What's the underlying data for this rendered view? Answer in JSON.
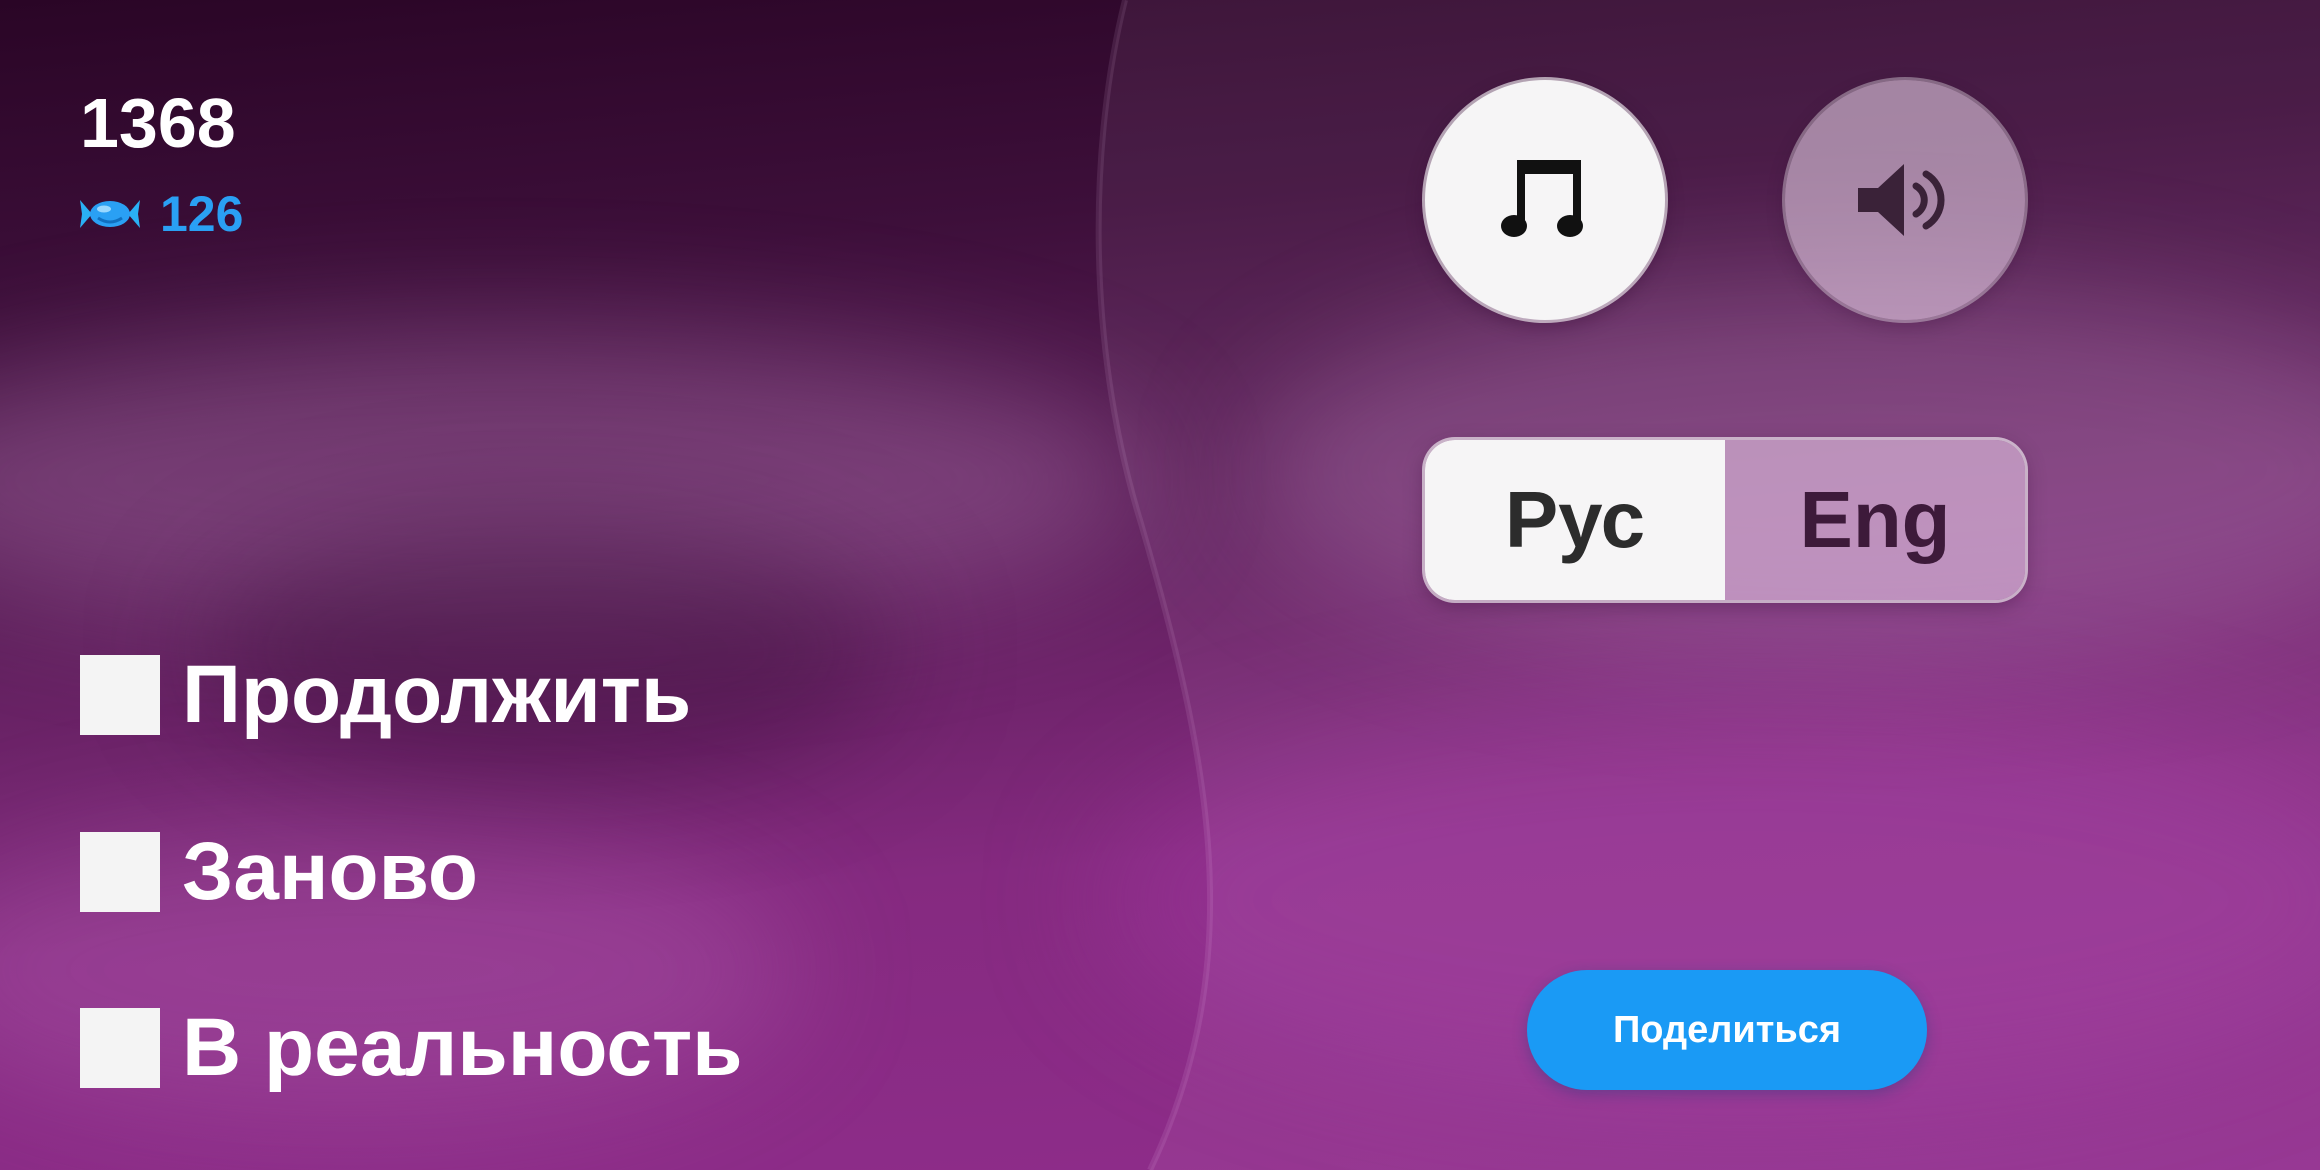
{
  "hud": {
    "score": "1368",
    "candies": "126",
    "candy_icon": "candy-icon"
  },
  "menu": {
    "items": [
      {
        "label": "Продолжить"
      },
      {
        "label": "Заново"
      },
      {
        "label": "В реальность"
      }
    ]
  },
  "settings": {
    "music_icon": "music-note-icon",
    "sound_icon": "speaker-icon",
    "music_on": true,
    "sound_on": false,
    "languages": [
      {
        "label": "Рус",
        "active": true
      },
      {
        "label": "Eng",
        "active": false
      }
    ]
  },
  "share": {
    "label": "Поделиться"
  },
  "colors": {
    "accent": "#1a9af5",
    "candy": "#2aa0f4",
    "background_top": "#2a0526",
    "background_bottom": "#902d8c"
  }
}
